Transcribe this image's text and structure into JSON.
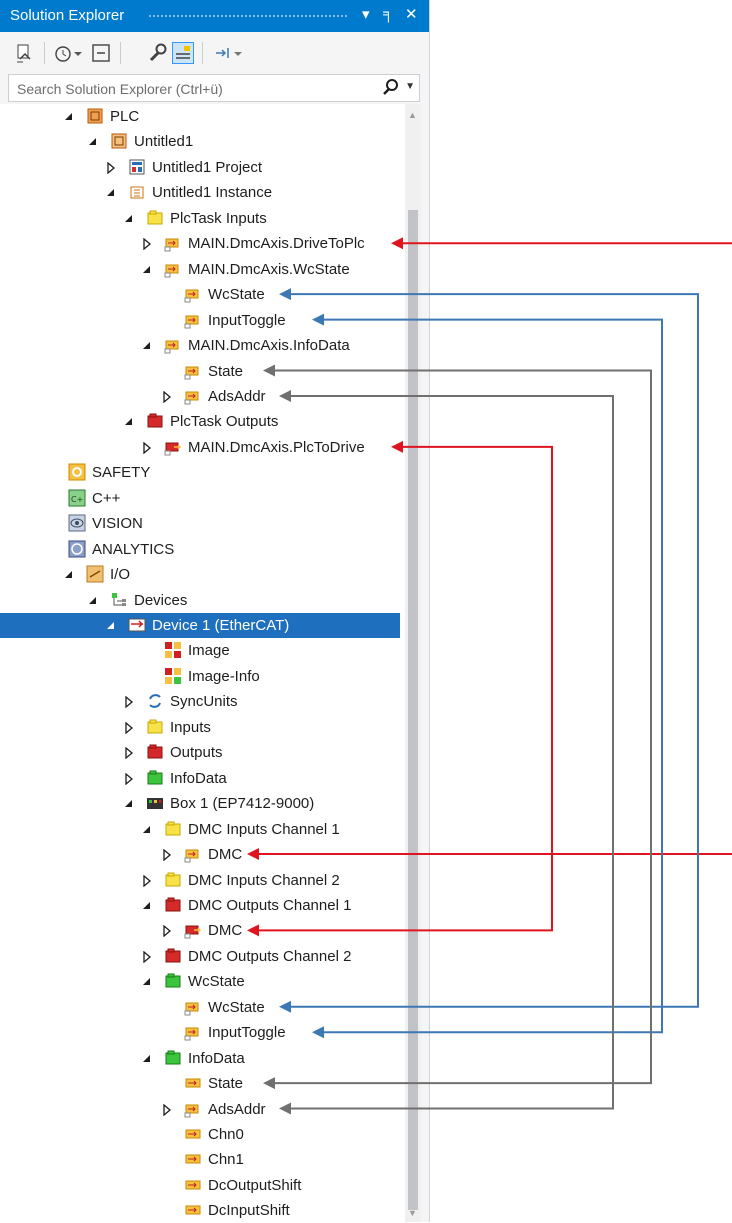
{
  "window": {
    "title": "Solution Explorer",
    "pin_glyph": "▾",
    "autohide_glyph": "╕",
    "close_glyph": "✕"
  },
  "search": {
    "placeholder": "Search Solution Explorer (Ctrl+ü)"
  },
  "toolbar": {
    "items": [
      "sync-with-document-icon",
      "pending-changes-icon",
      "collapse-all-icon",
      "properties-icon",
      "show-all-files-icon",
      "preview-icon"
    ]
  },
  "colors": {
    "accent": "#007acc",
    "selection": "#1f6fbf",
    "arrow_red": "#e0141e",
    "arrow_blue": "#3c78b4",
    "arrow_gray": "#707070"
  },
  "tree": [
    {
      "label": "PLC",
      "indent": 1,
      "expander": "open",
      "icon": "plc-icon"
    },
    {
      "label": "Untitled1",
      "indent": 2,
      "expander": "open",
      "icon": "plc-project-icon"
    },
    {
      "label": "Untitled1 Project",
      "indent": 3,
      "expander": "closed",
      "icon": "project-file-icon"
    },
    {
      "label": "Untitled1 Instance",
      "indent": 3,
      "expander": "open",
      "icon": "plc-instance-icon"
    },
    {
      "label": "PlcTask Inputs",
      "indent": 4,
      "expander": "open",
      "icon": "input-folder-icon"
    },
    {
      "label": "MAIN.DmcAxis.DriveToPlc",
      "indent": 5,
      "expander": "closed",
      "icon": "linked-input-var-icon"
    },
    {
      "label": "MAIN.DmcAxis.WcState",
      "indent": 5,
      "expander": "open",
      "icon": "linked-input-var-icon"
    },
    {
      "label": "WcState",
      "indent": 6,
      "expander": "none",
      "icon": "linked-input-var-icon"
    },
    {
      "label": "InputToggle",
      "indent": 6,
      "expander": "none",
      "icon": "linked-input-var-icon"
    },
    {
      "label": "MAIN.DmcAxis.InfoData",
      "indent": 5,
      "expander": "open",
      "icon": "linked-input-var-icon"
    },
    {
      "label": "State",
      "indent": 6,
      "expander": "none",
      "icon": "linked-input-var-icon"
    },
    {
      "label": "AdsAddr",
      "indent": 6,
      "expander": "closed",
      "icon": "linked-input-var-icon"
    },
    {
      "label": "PlcTask Outputs",
      "indent": 4,
      "expander": "open",
      "icon": "output-folder-icon"
    },
    {
      "label": "MAIN.DmcAxis.PlcToDrive",
      "indent": 5,
      "expander": "closed",
      "icon": "linked-output-var-icon"
    },
    {
      "label": "SAFETY",
      "indent": 0,
      "expander": "none",
      "icon": "safety-icon"
    },
    {
      "label": "C++",
      "indent": 0,
      "expander": "none",
      "icon": "cpp-icon"
    },
    {
      "label": "VISION",
      "indent": 0,
      "expander": "none",
      "icon": "vision-icon"
    },
    {
      "label": "ANALYTICS",
      "indent": 0,
      "expander": "none",
      "icon": "analytics-icon"
    },
    {
      "label": "I/O",
      "indent": 1,
      "expander": "open",
      "icon": "io-icon"
    },
    {
      "label": "Devices",
      "indent": 2,
      "expander": "open",
      "icon": "devices-icon"
    },
    {
      "label": "Device 1 (EtherCAT)",
      "indent": 3,
      "expander": "open",
      "icon": "ethercat-device-icon",
      "selected": true
    },
    {
      "label": "Image",
      "indent": 5,
      "expander": "none",
      "icon": "image-icon"
    },
    {
      "label": "Image-Info",
      "indent": 5,
      "expander": "none",
      "icon": "image-info-icon"
    },
    {
      "label": "SyncUnits",
      "indent": 4,
      "expander": "closed",
      "icon": "sync-units-icon"
    },
    {
      "label": "Inputs",
      "indent": 4,
      "expander": "closed",
      "icon": "input-folder-icon"
    },
    {
      "label": "Outputs",
      "indent": 4,
      "expander": "closed",
      "icon": "output-folder-icon"
    },
    {
      "label": "InfoData",
      "indent": 4,
      "expander": "closed",
      "icon": "infodata-folder-icon"
    },
    {
      "label": "Box 1 (EP7412-9000)",
      "indent": 4,
      "expander": "open",
      "icon": "ethercat-box-icon"
    },
    {
      "label": "DMC Inputs Channel 1",
      "indent": 5,
      "expander": "open",
      "icon": "input-folder-icon"
    },
    {
      "label": "DMC",
      "indent": 6,
      "expander": "closed",
      "icon": "linked-input-var-icon"
    },
    {
      "label": "DMC Inputs Channel 2",
      "indent": 5,
      "expander": "closed",
      "icon": "input-folder-icon"
    },
    {
      "label": "DMC Outputs Channel 1",
      "indent": 5,
      "expander": "open",
      "icon": "output-folder-icon"
    },
    {
      "label": "DMC",
      "indent": 6,
      "expander": "closed",
      "icon": "linked-output-var-icon"
    },
    {
      "label": "DMC Outputs Channel 2",
      "indent": 5,
      "expander": "closed",
      "icon": "output-folder-icon"
    },
    {
      "label": "WcState",
      "indent": 5,
      "expander": "open",
      "icon": "infodata-folder-icon"
    },
    {
      "label": "WcState",
      "indent": 6,
      "expander": "none",
      "icon": "linked-input-var-icon"
    },
    {
      "label": "InputToggle",
      "indent": 6,
      "expander": "none",
      "icon": "linked-input-var-icon"
    },
    {
      "label": "InfoData",
      "indent": 5,
      "expander": "open",
      "icon": "infodata-folder-icon"
    },
    {
      "label": "State",
      "indent": 6,
      "expander": "none",
      "icon": "input-var-icon"
    },
    {
      "label": "AdsAddr",
      "indent": 6,
      "expander": "closed",
      "icon": "linked-input-var-icon"
    },
    {
      "label": "Chn0",
      "indent": 6,
      "expander": "none",
      "icon": "input-var-icon"
    },
    {
      "label": "Chn1",
      "indent": 6,
      "expander": "none",
      "icon": "input-var-icon"
    },
    {
      "label": "DcOutputShift",
      "indent": 6,
      "expander": "none",
      "icon": "input-var-icon"
    },
    {
      "label": "DcInputShift",
      "indent": 6,
      "expander": "none",
      "icon": "input-var-icon"
    }
  ],
  "links": [
    {
      "from": 5,
      "to": 29,
      "color": "red",
      "style": "offscreen"
    },
    {
      "from": 13,
      "to": 32,
      "color": "red",
      "style": "loop",
      "gutter": 552
    },
    {
      "from": 7,
      "to": 35,
      "color": "blue",
      "style": "loop",
      "gutter": 698
    },
    {
      "from": 8,
      "to": 36,
      "color": "blue",
      "style": "loop",
      "gutter": 662
    },
    {
      "from": 10,
      "to": 38,
      "color": "gray",
      "style": "loop",
      "gutter": 651
    },
    {
      "from": 11,
      "to": 39,
      "color": "gray",
      "style": "loop",
      "gutter": 613
    }
  ]
}
